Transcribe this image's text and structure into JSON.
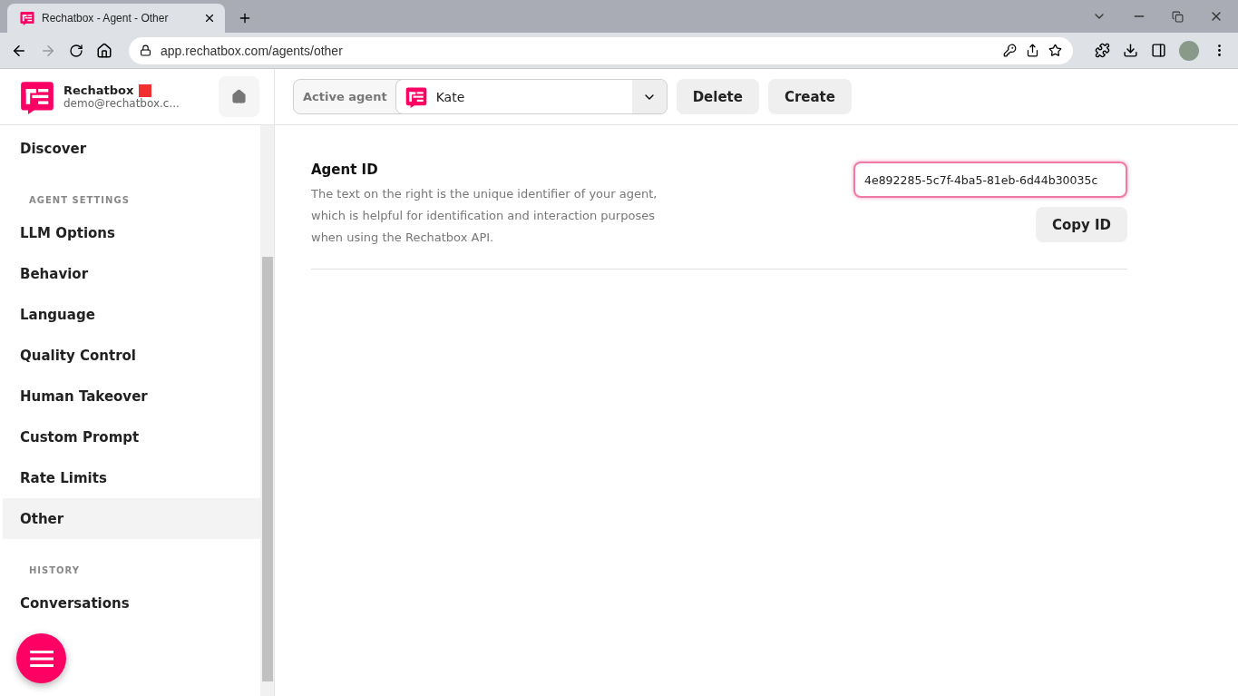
{
  "browser": {
    "tab": {
      "title": "Rechatbox - Agent - Other",
      "selected": true
    },
    "url": "app.rechatbox.com/agents/other"
  },
  "brand": {
    "name": "Rechatbox",
    "email": "demo@rechatbox.c..."
  },
  "agent_bar": {
    "label": "Active agent",
    "agent": "Kate",
    "buttons": [
      "Delete",
      "Create"
    ]
  },
  "sidebar": {
    "items": [
      {
        "kind": "item",
        "label": "Discover",
        "selected": false
      },
      {
        "kind": "heading",
        "label": "AGENT SETTINGS"
      },
      {
        "kind": "item",
        "label": "LLM Options",
        "selected": false
      },
      {
        "kind": "item",
        "label": "Behavior",
        "selected": false
      },
      {
        "kind": "item",
        "label": "Language",
        "selected": false
      },
      {
        "kind": "item",
        "label": "Quality Control",
        "selected": false
      },
      {
        "kind": "item",
        "label": "Human Takeover",
        "selected": false
      },
      {
        "kind": "item",
        "label": "Custom Prompt",
        "selected": false
      },
      {
        "kind": "item",
        "label": "Rate Limits",
        "selected": false
      },
      {
        "kind": "item",
        "label": "Other",
        "selected": true
      },
      {
        "kind": "heading",
        "label": "HISTORY"
      },
      {
        "kind": "item",
        "label": "Conversations",
        "selected": false
      }
    ]
  },
  "agent_id": {
    "title": "Agent ID",
    "description": "The text on the right is the unique identifier of your agent, which is helpful for identification and interaction purposes when using the Rechatbox API.",
    "value": "4e892285-5c7f-4ba5-81eb-6d44b30035c",
    "button": "Copy ID"
  }
}
